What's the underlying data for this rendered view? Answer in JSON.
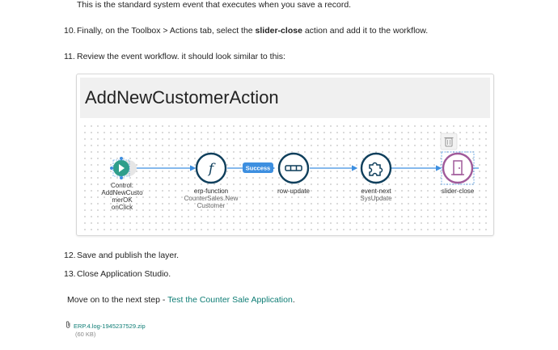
{
  "intro_text": "This is the standard system event that executes when you save a record.",
  "steps": [
    {
      "num": "10.",
      "before": "Finally, on the Toolbox > Actions tab, select the ",
      "bold": "slider-close",
      "after": " action and add it to the workflow."
    },
    {
      "num": "11.",
      "text": "Review the event workflow. it should look similar to this:"
    },
    {
      "num": "12.",
      "text": "Save and publish the layer."
    },
    {
      "num": "13.",
      "text": "Close Application Studio."
    }
  ],
  "diagram": {
    "title": "AddNewCustomerAction",
    "nodes": [
      {
        "label": "Control:",
        "sub_lines": [
          "AddNewCusto",
          "merOK",
          "onClick"
        ]
      },
      {
        "label": "erp-function",
        "sub_lines": [
          "CounterSales.New",
          "Customer"
        ]
      },
      {
        "label": "row-update",
        "sub_lines": []
      },
      {
        "label": "event-next",
        "sub_lines": [
          "SysUpdate"
        ]
      },
      {
        "label": "slider-close",
        "sub_lines": []
      }
    ],
    "success_label": "Success",
    "colors": {
      "accent": "#0f3f5c",
      "connector": "#3d8fe0",
      "success_badge": "#3d8fe0",
      "slider_close": "#a05a9a",
      "start": "#2e9e8b"
    }
  },
  "next_step": {
    "prefix": "Move on to the next step - ",
    "link": "Test the Counter Sale Application",
    "suffix": "."
  },
  "attachment": {
    "icon": "paperclip-icon",
    "filename": "ERP.4.log-1945237529.zip",
    "size": "(60 KB)"
  }
}
